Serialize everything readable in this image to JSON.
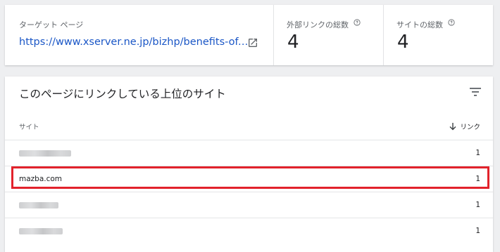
{
  "summary": {
    "target_label": "ターゲット ページ",
    "target_url": "https://www.xserver.ne.jp/bizhp/benefits-of-l...",
    "external_links_label": "外部リンクの総数",
    "external_links_value": "4",
    "sites_label": "サイトの総数",
    "sites_value": "4"
  },
  "section": {
    "title": "このページにリンクしている上位のサイト",
    "col_site": "サイト",
    "col_links": "リンク"
  },
  "rows": [
    {
      "site": "",
      "count": "1",
      "blurred": true
    },
    {
      "site": "mazba.com",
      "count": "1",
      "blurred": false
    },
    {
      "site": "",
      "count": "1",
      "blurred": true
    },
    {
      "site": "",
      "count": "1",
      "blurred": true
    }
  ],
  "colors": {
    "link": "#1a56c6",
    "highlight": "#e2222b"
  }
}
